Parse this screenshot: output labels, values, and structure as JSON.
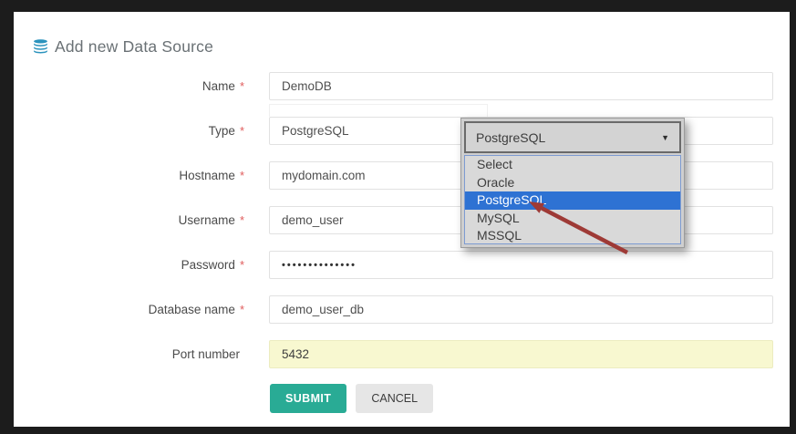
{
  "window": {
    "background_color": "#1c1c1c",
    "panel_background_color": "#ffffff"
  },
  "header": {
    "title": "Add new Data Source",
    "icon": "database-icon",
    "icon_color": "#2b93bd",
    "title_color": "#6a7175"
  },
  "form": {
    "required_marker": "*",
    "fields": [
      {
        "label": "Name",
        "marker": "*",
        "value": "DemoDB"
      },
      {
        "label": "Type",
        "marker": "*",
        "value": "PostgreSQL"
      },
      {
        "label": "Hostname",
        "marker": "*",
        "value": "mydomain.com"
      },
      {
        "label": "Username",
        "marker": "*",
        "value": "demo_user"
      },
      {
        "label": "Password",
        "marker": "*",
        "value": "••••••••••••••",
        "masked": true
      },
      {
        "label": "Database name",
        "marker": "*",
        "value": "demo_user_db"
      },
      {
        "label": "Port number",
        "marker": "",
        "value": "5432",
        "highlighted": true
      }
    ],
    "buttons": {
      "submit": "SUBMIT",
      "cancel": "CANCEL"
    },
    "colors": {
      "submit_bg": "#29ab95",
      "cancel_bg": "#e6e6e6",
      "port_field_bg": "#f8f8d0",
      "required_marker": "#e05c5c"
    }
  },
  "dropdown": {
    "selected": "PostgreSQL",
    "caret": "▼",
    "options": [
      "Select",
      "Oracle",
      "PostgreSQL",
      "MySQL",
      "MSSQL"
    ],
    "highlighted_index": 2,
    "highlight_color": "#2e72d3",
    "annotation": {
      "type": "arrow",
      "color": "#9e3a36",
      "points_to": "PostgreSQL"
    }
  }
}
